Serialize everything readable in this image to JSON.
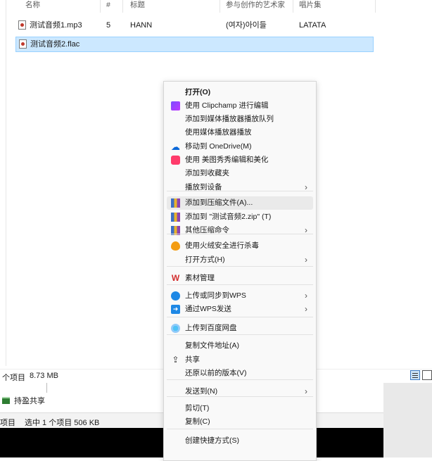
{
  "columns": {
    "name": "名称",
    "number": "#",
    "title": "标题",
    "artist": "参与创作的艺术家",
    "album": "唱片集"
  },
  "files": [
    {
      "name": "测试音频1.mp3",
      "number": "5",
      "title": "HANN",
      "artist": "(여자)아이들",
      "album": "LATATA",
      "selected": false
    },
    {
      "name": "测试音频2.flac",
      "number": "",
      "title": "",
      "artist": "",
      "album": "",
      "selected": true
    }
  ],
  "context_menu": {
    "items": [
      {
        "label": "打开(O)",
        "icon": "",
        "submenu": false,
        "bold": true
      },
      {
        "label": "使用 Clipchamp 进行编辑",
        "icon": "clipchamp-icon",
        "submenu": false
      },
      {
        "label": "添加到媒体播放器播放队列",
        "icon": "",
        "submenu": false
      },
      {
        "label": "使用媒体播放器播放",
        "icon": "",
        "submenu": false
      },
      {
        "label": "移动到 OneDrive(M)",
        "icon": "onedrive-icon",
        "submenu": false
      },
      {
        "label": "使用 美图秀秀编辑和美化",
        "icon": "meitu-icon",
        "submenu": false
      },
      {
        "label": "添加到收藏夹",
        "icon": "",
        "submenu": false
      },
      {
        "label": "播放到设备",
        "icon": "",
        "submenu": true
      },
      {
        "label": "添加到压缩文件(A)...",
        "icon": "winrar-icon",
        "submenu": false,
        "hover": true
      },
      {
        "label": "添加到 \"测试音频2.zip\" (T)",
        "icon": "winrar-icon",
        "submenu": false
      },
      {
        "label": "其他压缩命令",
        "icon": "winrar-icon",
        "submenu": true
      },
      {
        "label": "使用火绒安全进行杀毒",
        "icon": "huorong-icon",
        "submenu": false
      },
      {
        "label": "打开方式(H)",
        "icon": "",
        "submenu": true
      },
      {
        "label": "素材管理",
        "icon": "wps-icon",
        "submenu": false
      },
      {
        "label": "上传或同步到WPS",
        "icon": "cloud-upload-icon",
        "submenu": true
      },
      {
        "label": "通过WPS发送",
        "icon": "send-icon",
        "submenu": true
      },
      {
        "label": "上传到百度网盘",
        "icon": "baidu-netdisk-icon",
        "submenu": false
      },
      {
        "label": "复制文件地址(A)",
        "icon": "",
        "submenu": false
      },
      {
        "label": "共享",
        "icon": "share-icon",
        "submenu": false
      },
      {
        "label": "还原以前的版本(V)",
        "icon": "",
        "submenu": false
      },
      {
        "label": "发送到(N)",
        "icon": "",
        "submenu": true
      },
      {
        "label": "剪切(T)",
        "icon": "",
        "submenu": false
      },
      {
        "label": "复制(C)",
        "icon": "",
        "submenu": false
      },
      {
        "label": "创建快捷方式(S)",
        "icon": "",
        "submenu": false
      }
    ]
  },
  "status": {
    "count_text": "个项目",
    "size_text": "8.73 MB",
    "behind_item": "持盈共享",
    "bottom_items_text": "项目",
    "bottom_selected_text": "选中 1 个项目  506 KB"
  },
  "colors": {
    "selection": "#cce8ff",
    "menu_bg": "#f9f9f9",
    "hover": "#eaeaea"
  }
}
